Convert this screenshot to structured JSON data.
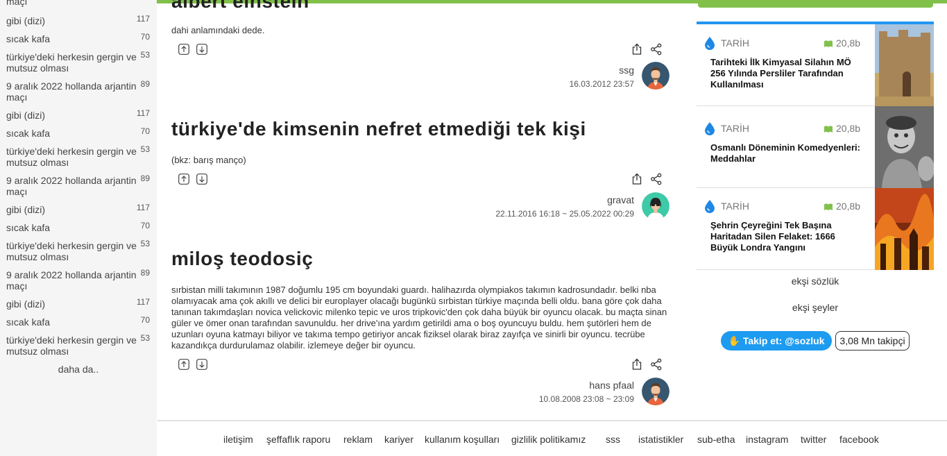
{
  "sidebar": {
    "items": [
      {
        "title": "maçı",
        "count": ""
      },
      {
        "title": "gibi (dizi)",
        "count": "117"
      },
      {
        "title": "sıcak kafa",
        "count": "70"
      },
      {
        "title": "türkiye'deki herkesin gergin ve mutsuz olması",
        "count": "53"
      },
      {
        "title": "9 aralık 2022 hollanda arjantin maçı",
        "count": "89"
      },
      {
        "title": "gibi (dizi)",
        "count": "117"
      },
      {
        "title": "sıcak kafa",
        "count": "70"
      },
      {
        "title": "türkiye'deki herkesin gergin ve mutsuz olması",
        "count": "53"
      },
      {
        "title": "9 aralık 2022 hollanda arjantin maçı",
        "count": "89"
      },
      {
        "title": "gibi (dizi)",
        "count": "117"
      },
      {
        "title": "sıcak kafa",
        "count": "70"
      },
      {
        "title": "türkiye'deki herkesin gergin ve mutsuz olması",
        "count": "53"
      },
      {
        "title": "9 aralık 2022 hollanda arjantin maçı",
        "count": "89"
      },
      {
        "title": "gibi (dizi)",
        "count": "117"
      },
      {
        "title": "sıcak kafa",
        "count": "70"
      },
      {
        "title": "türkiye'deki herkesin gergin ve mutsuz olması",
        "count": "53"
      }
    ],
    "more": "daha da.."
  },
  "entries": [
    {
      "title": "albert einstein",
      "body": "dahi anlamındaki dede.",
      "author": "ssg",
      "date": "16.03.2012 23:57"
    },
    {
      "title": "türkiye'de kimsenin nefret etmediği tek kişi",
      "body": "(bkz: barış manço)",
      "author": "gravat",
      "date": "22.11.2016 16:18 ~ 25.05.2022 00:29"
    },
    {
      "title": "miloş teodosiç",
      "body": "sırbistan milli takımının 1987 doğumlu 195 cm boyundaki guardı. halihazırda olympiakos takımın kadrosundadır. belki nba olamıyacak ama çok akıllı ve delici bir europlayer olacağı bugünkü sırbistan türkiye maçında belli oldu. bana göre çok daha tanınan takımdaşları novica velickovic milenko tepic ve uros tripkovic'den çok daha büyük bir oyuncu olacak. bu maçta sinan güler ve ömer onan tarafından savunuldu. her drive'ına yardım getirildi ama o boş oyuncuyu buldu. hem şutörleri hem de uzunları oyuna katmayı biliyor ve takıma tempo getiriyor ancak fiziksel olarak biraz zayıfça ve sinirli bir oyuncu. tecrübe kazandıkça durdurulamaz olabilir. izlemeye değer bir oyuncu.",
      "author": "hans pfaal",
      "date": "10.08.2008 23:08 ~ 23:09"
    }
  ],
  "footer": {
    "links": [
      "iletişim",
      "şeffaflık raporu",
      "reklam",
      "kariyer",
      "kullanım koşulları",
      "gizlilik politikamız",
      "sss",
      "istatistikler",
      "sub-etha",
      "instagram",
      "twitter",
      "facebook"
    ]
  },
  "right": {
    "cards": [
      {
        "category": "TARİH",
        "size": "20,8b",
        "title": "Tarihteki İlk Kimyasal Silahın MÖ 256 Yılında Persliler Tarafından Kullanılması"
      },
      {
        "category": "TARİH",
        "size": "20,8b",
        "title": "Osmanlı Döneminin Komedyenleri: Meddahlar"
      },
      {
        "category": "TARİH",
        "size": "20,8b",
        "title": "Şehrin Çeyreğini Tek Başına Haritadan Silen Felaket: 1666 Büyük Londra Yangını"
      }
    ],
    "links": [
      "ekşi sözlük",
      "ekşi şeyler"
    ],
    "follow_label": "Takip et: @sozluk",
    "follower_count": "3,08 Mn takipçi"
  },
  "colors": {
    "accent_green": "#81c14b",
    "accent_blue": "#2196f3",
    "twitter_blue": "#1d9bf0"
  }
}
